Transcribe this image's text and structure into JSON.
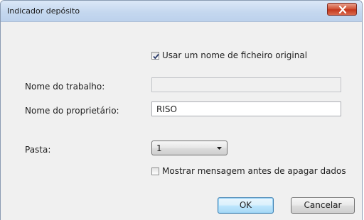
{
  "window": {
    "title": "Indicador depósito",
    "close_icon": "close-icon"
  },
  "form": {
    "use_original_filename": {
      "label": "Usar um nome de ficheiro original",
      "checked": true
    },
    "job_name": {
      "label": "Nome do trabalho:",
      "value": "",
      "disabled": true
    },
    "owner_name": {
      "label": "Nome do proprietário:",
      "value": "RISO"
    },
    "folder": {
      "label": "Pasta:",
      "selected": "1"
    },
    "show_message_before_delete": {
      "label": "Mostrar mensagem antes de apagar dados",
      "checked": false
    }
  },
  "buttons": {
    "ok": "OK",
    "cancel": "Cancelar"
  },
  "colors": {
    "close_button": "#c4371d",
    "default_button_border": "#3c7fb1"
  }
}
